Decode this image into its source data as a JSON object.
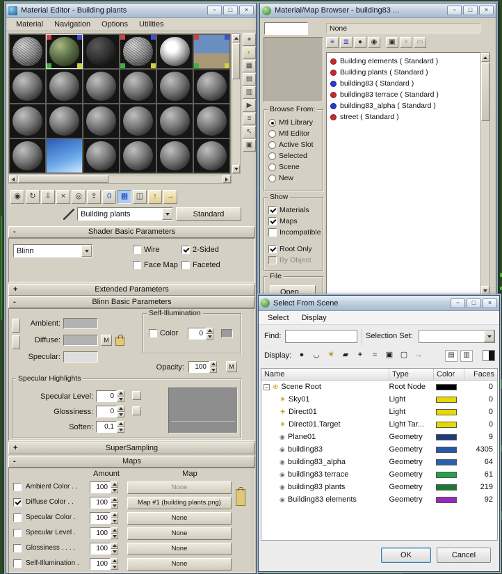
{
  "desktop": {
    "background": "#2e4a28",
    "accent_line_color": "#58c83e"
  },
  "window_controls": {
    "minimize": "−",
    "maximize": "□",
    "close": "×"
  },
  "material_editor": {
    "title": "Material Editor - Building plants",
    "menu": [
      "Material",
      "Navigation",
      "Options",
      "Utilities"
    ],
    "toolbar": [
      {
        "name": "get-material",
        "glyph": "◉"
      },
      {
        "name": "put-material-to-scene",
        "glyph": "↻"
      },
      {
        "name": "assign-material-to-selection",
        "glyph": "⇩"
      },
      {
        "name": "reset-map-mtl",
        "glyph": "×"
      },
      {
        "name": "make-material-copy",
        "glyph": "◎"
      },
      {
        "name": "put-to-library",
        "glyph": "⇪"
      },
      {
        "name": "material-id-channel",
        "glyph": "0"
      },
      {
        "name": "show-map-in-viewport",
        "glyph": "▦"
      },
      {
        "name": "show-end-result",
        "glyph": "◫"
      },
      {
        "name": "go-to-parent",
        "glyph": "↑"
      },
      {
        "name": "go-forward-to-sibling",
        "glyph": "→"
      }
    ],
    "slot_toolbar": [
      {
        "name": "sample-type",
        "glyph": "●"
      },
      {
        "name": "backlight",
        "glyph": "◐"
      },
      {
        "name": "background",
        "glyph": "▦"
      },
      {
        "name": "sample-uv-tiling",
        "glyph": "▤"
      },
      {
        "name": "video-color-check",
        "glyph": "▥"
      },
      {
        "name": "make-preview",
        "glyph": "▶"
      },
      {
        "name": "options",
        "glyph": "≡"
      },
      {
        "name": "select-by-material",
        "glyph": "↖"
      },
      {
        "name": "material-map-navigator",
        "glyph": "▣"
      }
    ],
    "sample_slots": [
      "noise",
      "plants-map-active",
      "dark",
      "noise-map",
      "light",
      "scene-map",
      "gray",
      "gray",
      "gray",
      "gray",
      "gray",
      "gray",
      "gray",
      "gray",
      "gray",
      "gray",
      "gray",
      "gray",
      "gray",
      "sky",
      "gray",
      "gray",
      "gray",
      "gray"
    ],
    "material_name": "Building plants",
    "type_button": "Standard",
    "rollouts": [
      {
        "state": "-",
        "title": "Shader Basic Parameters"
      },
      {
        "state": "+",
        "title": "Extended Parameters"
      },
      {
        "state": "-",
        "title": "Blinn Basic Parameters"
      },
      {
        "state": "+",
        "title": "SuperSampling"
      },
      {
        "state": "-",
        "title": "Maps"
      }
    ],
    "shader": {
      "type": "Blinn",
      "wire": "Wire",
      "two_sided": "2-Sided",
      "face_map": "Face Map",
      "faceted": "Faceted",
      "checked": {
        "wire": false,
        "two_sided": true,
        "face_map": false,
        "faceted": false
      }
    },
    "blinn": {
      "ambient_label": "Ambient:",
      "diffuse_label": "Diffuse:",
      "specular_label": "Specular:",
      "ambient_color": "#b2b2b2",
      "diffuse_color": "#b2b2b2",
      "specular_color": "#dedede",
      "m_button": "M",
      "self_illumination": {
        "title": "Self-Illumination",
        "color_label": "Color",
        "color_checked": false,
        "value": "0",
        "swatch": "#9c9c9c"
      },
      "opacity": {
        "label": "Opacity:",
        "value": "100"
      },
      "highlights": {
        "title": "Specular Highlights",
        "specular_level": {
          "label": "Specular Level:",
          "value": "0"
        },
        "glossiness": {
          "label": "Glossiness:",
          "value": "0"
        },
        "soften": {
          "label": "Soften:",
          "value": "0,1"
        }
      }
    },
    "maps": {
      "amount_header": "Amount",
      "map_header": "Map",
      "rows": [
        {
          "label": "Ambient Color . .",
          "checked": false,
          "amount": "100",
          "map": "None",
          "disabled": true
        },
        {
          "label": "Diffuse Color . .",
          "checked": true,
          "amount": "100",
          "map": "Map #1 (building plants.png)",
          "disabled": false
        },
        {
          "label": "Specular Color .",
          "checked": false,
          "amount": "100",
          "map": "None",
          "disabled": false
        },
        {
          "label": "Specular Level .",
          "checked": false,
          "amount": "100",
          "map": "None",
          "disabled": false
        },
        {
          "label": "Glossiness . . . .",
          "checked": false,
          "amount": "100",
          "map": "None",
          "disabled": false
        },
        {
          "label": "Self-Illumination .",
          "checked": false,
          "amount": "100",
          "map": "None",
          "disabled": false
        }
      ]
    }
  },
  "map_browser": {
    "title": "Material/Map Browser - building83 ...",
    "selection": "None",
    "filter_value": "",
    "toolbar": [
      {
        "name": "view-list",
        "glyph": "≡"
      },
      {
        "name": "view-list-icons",
        "glyph": "≣"
      },
      {
        "name": "view-small-icons",
        "glyph": "●"
      },
      {
        "name": "view-large-icons",
        "glyph": "◉"
      },
      {
        "name": "update-scene-materials",
        "glyph": "▣"
      },
      {
        "name": "delete-from-library",
        "glyph": "×"
      },
      {
        "name": "clear-material-library",
        "glyph": "▭"
      }
    ],
    "entries": [
      {
        "name": "Building elements ( Standard )",
        "dot": "#cc2a2a"
      },
      {
        "name": "Building plants ( Standard )",
        "dot": "#cc2a2a"
      },
      {
        "name": "building83 ( Standard )",
        "dot": "#2a3acc"
      },
      {
        "name": "building83 terrace ( Standard )",
        "dot": "#cc2a2a"
      },
      {
        "name": "building83_alpha ( Standard )",
        "dot": "#2a3acc"
      },
      {
        "name": "street ( Standard )",
        "dot": "#cc2a2a"
      }
    ],
    "browse_from": {
      "title": "Browse From:",
      "options": [
        {
          "label": "Mtl Library",
          "selected": true
        },
        {
          "label": "Mtl Editor",
          "selected": false
        },
        {
          "label": "Active Slot",
          "selected": false
        },
        {
          "label": "Selected",
          "selected": false
        },
        {
          "label": "Scene",
          "selected": false
        },
        {
          "label": "New",
          "selected": false
        }
      ]
    },
    "show": {
      "title": "Show",
      "options": [
        {
          "label": "Materials",
          "checked": true,
          "disabled": false
        },
        {
          "label": "Maps",
          "checked": true,
          "disabled": false
        },
        {
          "label": "Incompatible",
          "checked": false,
          "disabled": false
        },
        {
          "label": "Root Only",
          "checked": true,
          "disabled": false
        },
        {
          "label": "By Object",
          "checked": false,
          "disabled": true
        }
      ]
    },
    "file": {
      "title": "File",
      "open_button": "Open..."
    }
  },
  "select_scene": {
    "title": "Select From Scene",
    "menu": [
      "Select",
      "Display"
    ],
    "find_label": "Find:",
    "find_value": "",
    "selection_set_label": "Selection Set:",
    "selection_set_value": "",
    "display_label": "Display:",
    "display_toolbar": [
      {
        "name": "display-geometry",
        "glyph": "●"
      },
      {
        "name": "display-shapes",
        "glyph": "◡"
      },
      {
        "name": "display-lights",
        "glyph": "☀"
      },
      {
        "name": "display-cameras",
        "glyph": "▰"
      },
      {
        "name": "display-helpers",
        "glyph": "+"
      },
      {
        "name": "display-space-warps",
        "glyph": "≈"
      },
      {
        "name": "display-groups",
        "glyph": "▣"
      },
      {
        "name": "display-xrefs",
        "glyph": "▢"
      },
      {
        "name": "display-bones",
        "glyph": "→"
      }
    ],
    "list_toggles": [
      {
        "name": "display-list-view",
        "glyph": "▤"
      },
      {
        "name": "display-hierarchy-view",
        "glyph": "▥"
      }
    ],
    "expander": "−",
    "icon_glyphs": {
      "scene_root": "⊕",
      "light": "☀",
      "geometry": "◉"
    },
    "columns": [
      "Name",
      "Type",
      "Color",
      "Faces"
    ],
    "rows": [
      {
        "name": "Scene Root",
        "type": "Root Node",
        "color": "#000000",
        "faces": "0",
        "level": 0,
        "icon": "scene_root"
      },
      {
        "name": "Sky01",
        "type": "Light",
        "color": "#e8d800",
        "faces": "0",
        "level": 1,
        "icon": "light"
      },
      {
        "name": "Direct01",
        "type": "Light",
        "color": "#e8d800",
        "faces": "0",
        "level": 1,
        "icon": "light"
      },
      {
        "name": "Direct01.Target",
        "type": "Light Tar...",
        "color": "#e8d800",
        "faces": "0",
        "level": 1,
        "icon": "light"
      },
      {
        "name": "Plane01",
        "type": "Geometry",
        "color": "#1e3c78",
        "faces": "9",
        "level": 1,
        "icon": "geometry"
      },
      {
        "name": "building83",
        "type": "Geometry",
        "color": "#2858a8",
        "faces": "4305",
        "level": 1,
        "icon": "geometry"
      },
      {
        "name": "building83_alpha",
        "type": "Geometry",
        "color": "#2860b0",
        "faces": "64",
        "level": 1,
        "icon": "geometry"
      },
      {
        "name": "building83 terrace",
        "type": "Geometry",
        "color": "#28a048",
        "faces": "61",
        "level": 1,
        "icon": "geometry"
      },
      {
        "name": "building83 plants",
        "type": "Geometry",
        "color": "#1a7830",
        "faces": "219",
        "level": 1,
        "icon": "geometry"
      },
      {
        "name": "Building83 elements",
        "type": "Geometry",
        "color": "#9828b8",
        "faces": "92",
        "level": 1,
        "icon": "geometry"
      }
    ],
    "ok_button": "OK",
    "cancel_button": "Cancel"
  }
}
